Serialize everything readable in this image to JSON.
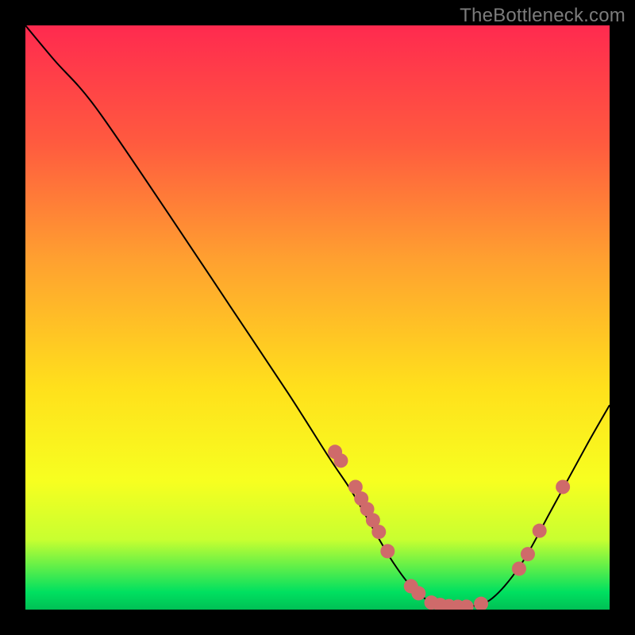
{
  "watermark": "TheBottleneck.com",
  "chart_data": {
    "type": "line",
    "title": "",
    "xlabel": "",
    "ylabel": "",
    "xlim": [
      0,
      100
    ],
    "ylim": [
      0,
      100
    ],
    "curve": [
      {
        "x": 0,
        "y": 100
      },
      {
        "x": 5,
        "y": 94
      },
      {
        "x": 12,
        "y": 86
      },
      {
        "x": 25,
        "y": 67
      },
      {
        "x": 35,
        "y": 52
      },
      {
        "x": 45,
        "y": 37
      },
      {
        "x": 52,
        "y": 26
      },
      {
        "x": 56,
        "y": 20
      },
      {
        "x": 60,
        "y": 13
      },
      {
        "x": 63,
        "y": 8
      },
      {
        "x": 66,
        "y": 4
      },
      {
        "x": 69,
        "y": 1.5
      },
      {
        "x": 72,
        "y": 0.5
      },
      {
        "x": 76,
        "y": 0.5
      },
      {
        "x": 80,
        "y": 2
      },
      {
        "x": 85,
        "y": 8
      },
      {
        "x": 90,
        "y": 17
      },
      {
        "x": 96,
        "y": 28
      },
      {
        "x": 100,
        "y": 35
      }
    ],
    "markers": [
      {
        "x": 53,
        "y": 27
      },
      {
        "x": 54,
        "y": 25.5
      },
      {
        "x": 56.5,
        "y": 21
      },
      {
        "x": 57.5,
        "y": 19
      },
      {
        "x": 58.5,
        "y": 17.2
      },
      {
        "x": 59.5,
        "y": 15.3
      },
      {
        "x": 60.5,
        "y": 13.3
      },
      {
        "x": 62,
        "y": 10
      },
      {
        "x": 66,
        "y": 4
      },
      {
        "x": 67.3,
        "y": 2.8
      },
      {
        "x": 69.5,
        "y": 1.2
      },
      {
        "x": 71,
        "y": 0.8
      },
      {
        "x": 72.5,
        "y": 0.6
      },
      {
        "x": 74,
        "y": 0.5
      },
      {
        "x": 75.5,
        "y": 0.5
      },
      {
        "x": 78,
        "y": 1.0
      },
      {
        "x": 84.5,
        "y": 7
      },
      {
        "x": 86,
        "y": 9.5
      },
      {
        "x": 88,
        "y": 13.5
      },
      {
        "x": 92,
        "y": 21
      }
    ],
    "marker_color": "#cf6a6a",
    "marker_radius": 9,
    "curve_color": "#000000",
    "curve_width": 2
  }
}
